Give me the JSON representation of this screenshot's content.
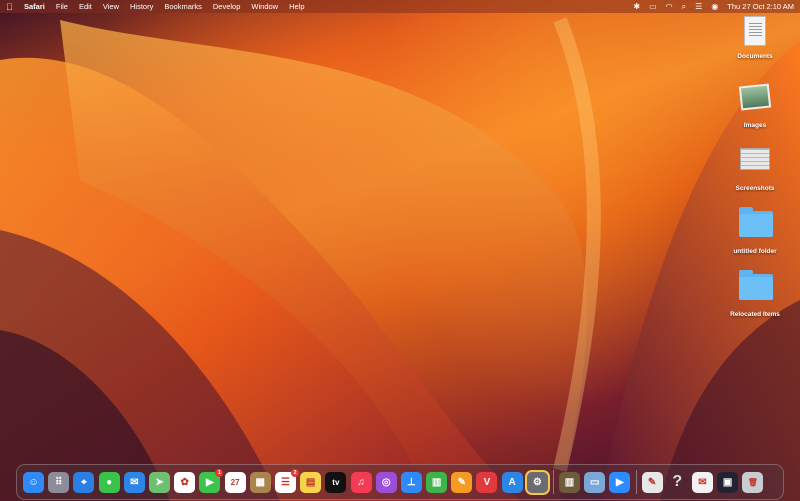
{
  "menubar": {
    "apple_icon": "apple-logo-icon",
    "app_name": "Safari",
    "menus": [
      "File",
      "Edit",
      "View",
      "History",
      "Bookmarks",
      "Develop",
      "Window",
      "Help"
    ],
    "status_icons": [
      "bluetooth-icon",
      "battery-icon",
      "wifi-icon",
      "search-icon",
      "control-center-icon",
      "user-icon"
    ],
    "clock": "Thu 27 Oct  2:10 AM"
  },
  "desktop_icons": [
    {
      "label": "Documents",
      "icon": "document-icon"
    },
    {
      "label": "Images",
      "icon": "image-icon"
    },
    {
      "label": "Screenshots",
      "icon": "screenshot-icon"
    },
    {
      "label": "untitled folder",
      "icon": "folder-icon"
    },
    {
      "label": "Relocated Items",
      "icon": "folder-icon"
    }
  ],
  "dock": {
    "items": [
      {
        "name": "finder",
        "color": "#2f8af5",
        "glyph": "☺"
      },
      {
        "name": "launchpad",
        "color": "#8c8c9a",
        "glyph": "⠿"
      },
      {
        "name": "safari",
        "color": "#2b7fe0",
        "glyph": "⌖"
      },
      {
        "name": "messages",
        "color": "#3bc44b",
        "glyph": "●"
      },
      {
        "name": "mail",
        "color": "#2b86e8",
        "glyph": "✉"
      },
      {
        "name": "maps",
        "color": "#6cc070",
        "glyph": "➤"
      },
      {
        "name": "photos",
        "color": "#ffffff",
        "glyph": "✿"
      },
      {
        "name": "facetime",
        "color": "#3bc44b",
        "glyph": "▶",
        "badge": "1"
      },
      {
        "name": "calendar",
        "color": "#ffffff",
        "glyph": "27"
      },
      {
        "name": "notes-brown",
        "color": "#a9844d",
        "glyph": "▦"
      },
      {
        "name": "reminders",
        "color": "#ffffff",
        "glyph": "☰",
        "badge": "2"
      },
      {
        "name": "notes",
        "color": "#f6d44a",
        "glyph": "▤"
      },
      {
        "name": "apple-tv",
        "color": "#111111",
        "glyph": "tv"
      },
      {
        "name": "music",
        "color": "#f43b54",
        "glyph": "♫"
      },
      {
        "name": "podcasts",
        "color": "#9b4fd9",
        "glyph": "◎"
      },
      {
        "name": "keynote",
        "color": "#2f8af5",
        "glyph": "⊥"
      },
      {
        "name": "numbers",
        "color": "#3bb54a",
        "glyph": "▥"
      },
      {
        "name": "pages",
        "color": "#f59a23",
        "glyph": "✎"
      },
      {
        "name": "vivaldi",
        "color": "#e0393e",
        "glyph": "V"
      },
      {
        "name": "app-store",
        "color": "#2b86e8",
        "glyph": "A"
      },
      {
        "name": "system-preferences",
        "color": "#6b6b72",
        "glyph": "⚙",
        "highlight": true
      },
      {
        "name": "books-shelf",
        "color": "#6f5a3a",
        "glyph": "▥"
      },
      {
        "name": "preview",
        "color": "#7ba7d8",
        "glyph": "▭"
      },
      {
        "name": "zoom",
        "color": "#2d8cff",
        "glyph": "▶"
      },
      {
        "name": "script-editor",
        "color": "#e8e8e8",
        "glyph": "✎"
      },
      {
        "name": "help",
        "color": "transparent",
        "glyph": "?"
      },
      {
        "name": "stamp",
        "color": "#f2f2f2",
        "glyph": "✉"
      },
      {
        "name": "screen-window",
        "color": "#222233",
        "glyph": "▣"
      },
      {
        "name": "trash",
        "color": "#c9cdd2",
        "glyph": "🗑"
      }
    ]
  }
}
